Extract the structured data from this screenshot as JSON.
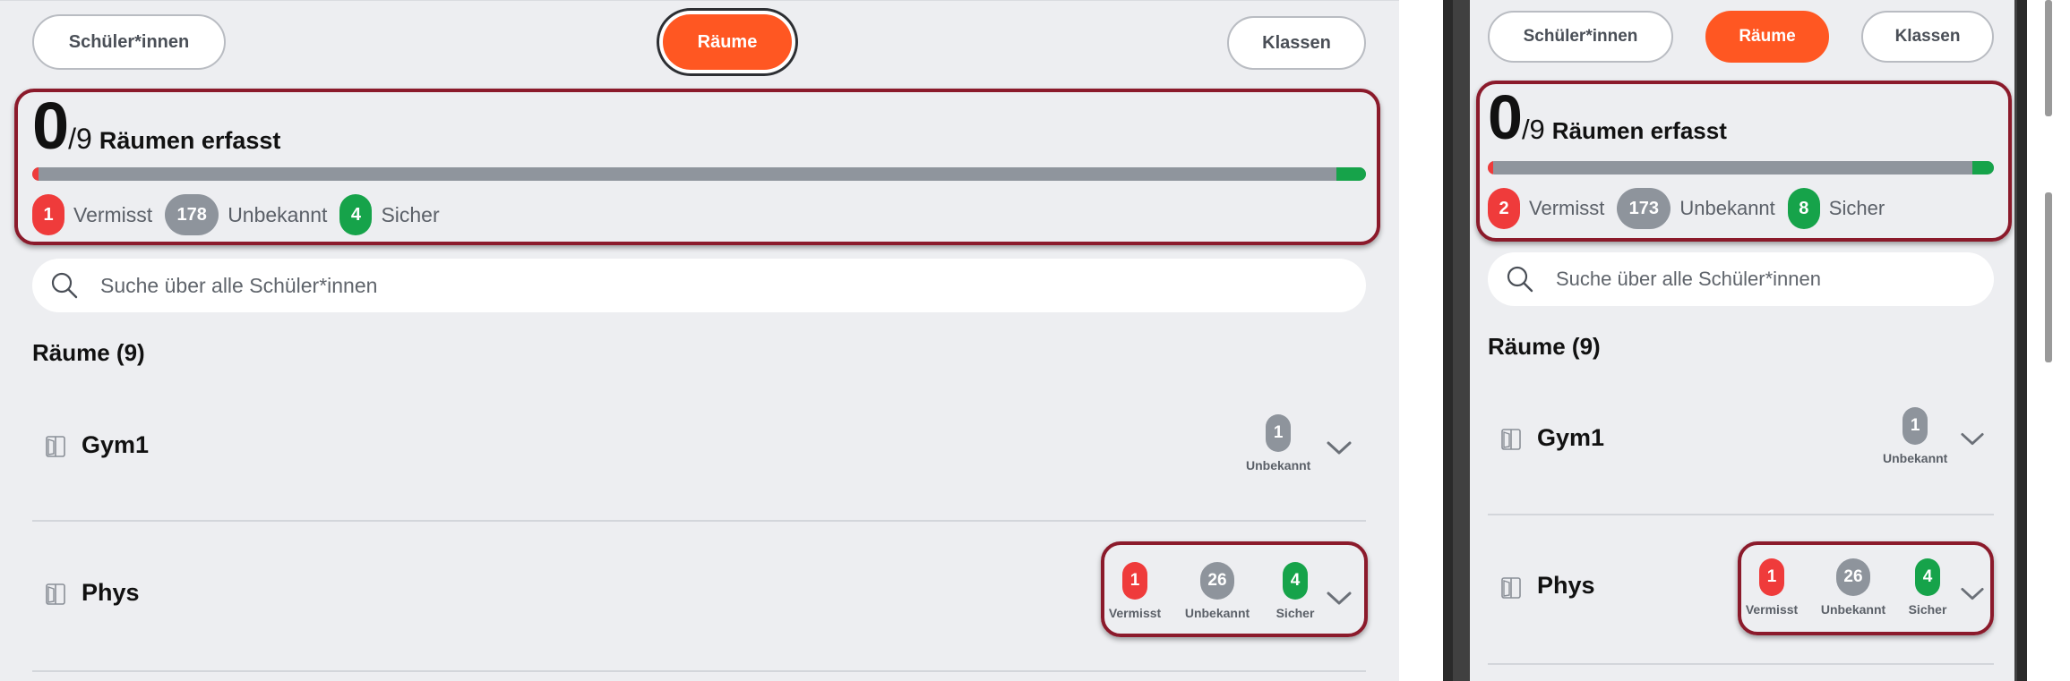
{
  "tabs": [
    "Schüler*innen",
    "Räume",
    "Klassen"
  ],
  "active_tab": "Räume",
  "left": {
    "captured": "0",
    "total": "/9",
    "captured_label": "Räumen erfasst",
    "legend": {
      "missing_count": "1",
      "missing_label": "Vermisst",
      "unknown_count": "178",
      "unknown_label": "Unbekannt",
      "safe_count": "4",
      "safe_label": "Sicher"
    },
    "progress": {
      "missing": 0.005,
      "unknown": 0.973,
      "safe": 0.022
    },
    "search_placeholder": "Suche über alle Schüler*innen",
    "section_title": "Räume (9)",
    "rooms": [
      {
        "name": "Gym1",
        "stats": [
          {
            "count": "1",
            "label": "Unbekannt",
            "color": "grey"
          }
        ]
      },
      {
        "name": "Phys",
        "stats": [
          {
            "count": "1",
            "label": "Vermisst",
            "color": "red"
          },
          {
            "count": "26",
            "label": "Unbekannt",
            "color": "grey"
          },
          {
            "count": "4",
            "label": "Sicher",
            "color": "green"
          }
        ]
      }
    ]
  },
  "right": {
    "captured": "0",
    "total": "/9",
    "captured_label": "Räumen erfasst",
    "legend": {
      "missing_count": "2",
      "missing_label": "Vermisst",
      "unknown_count": "173",
      "unknown_label": "Unbekannt",
      "safe_count": "8",
      "safe_label": "Sicher"
    },
    "progress": {
      "missing": 0.011,
      "unknown": 0.946,
      "safe": 0.043
    },
    "search_placeholder": "Suche über alle Schüler*innen",
    "section_title": "Räume (9)",
    "rooms": [
      {
        "name": "Gym1",
        "stats": [
          {
            "count": "1",
            "label": "Unbekannt",
            "color": "grey"
          }
        ]
      },
      {
        "name": "Phys",
        "stats": [
          {
            "count": "1",
            "label": "Vermisst",
            "color": "red"
          },
          {
            "count": "26",
            "label": "Unbekannt",
            "color": "grey"
          },
          {
            "count": "4",
            "label": "Sicher",
            "color": "green"
          }
        ]
      }
    ]
  },
  "colors": {
    "accent": "#ff5722",
    "missing": "#ef3b3b",
    "unknown": "#8e949c",
    "safe": "#16a34a",
    "highlight": "#8b1a2b"
  },
  "icons": {
    "search": "search-icon",
    "room": "door-icon",
    "expand": "chevron-down-icon"
  }
}
